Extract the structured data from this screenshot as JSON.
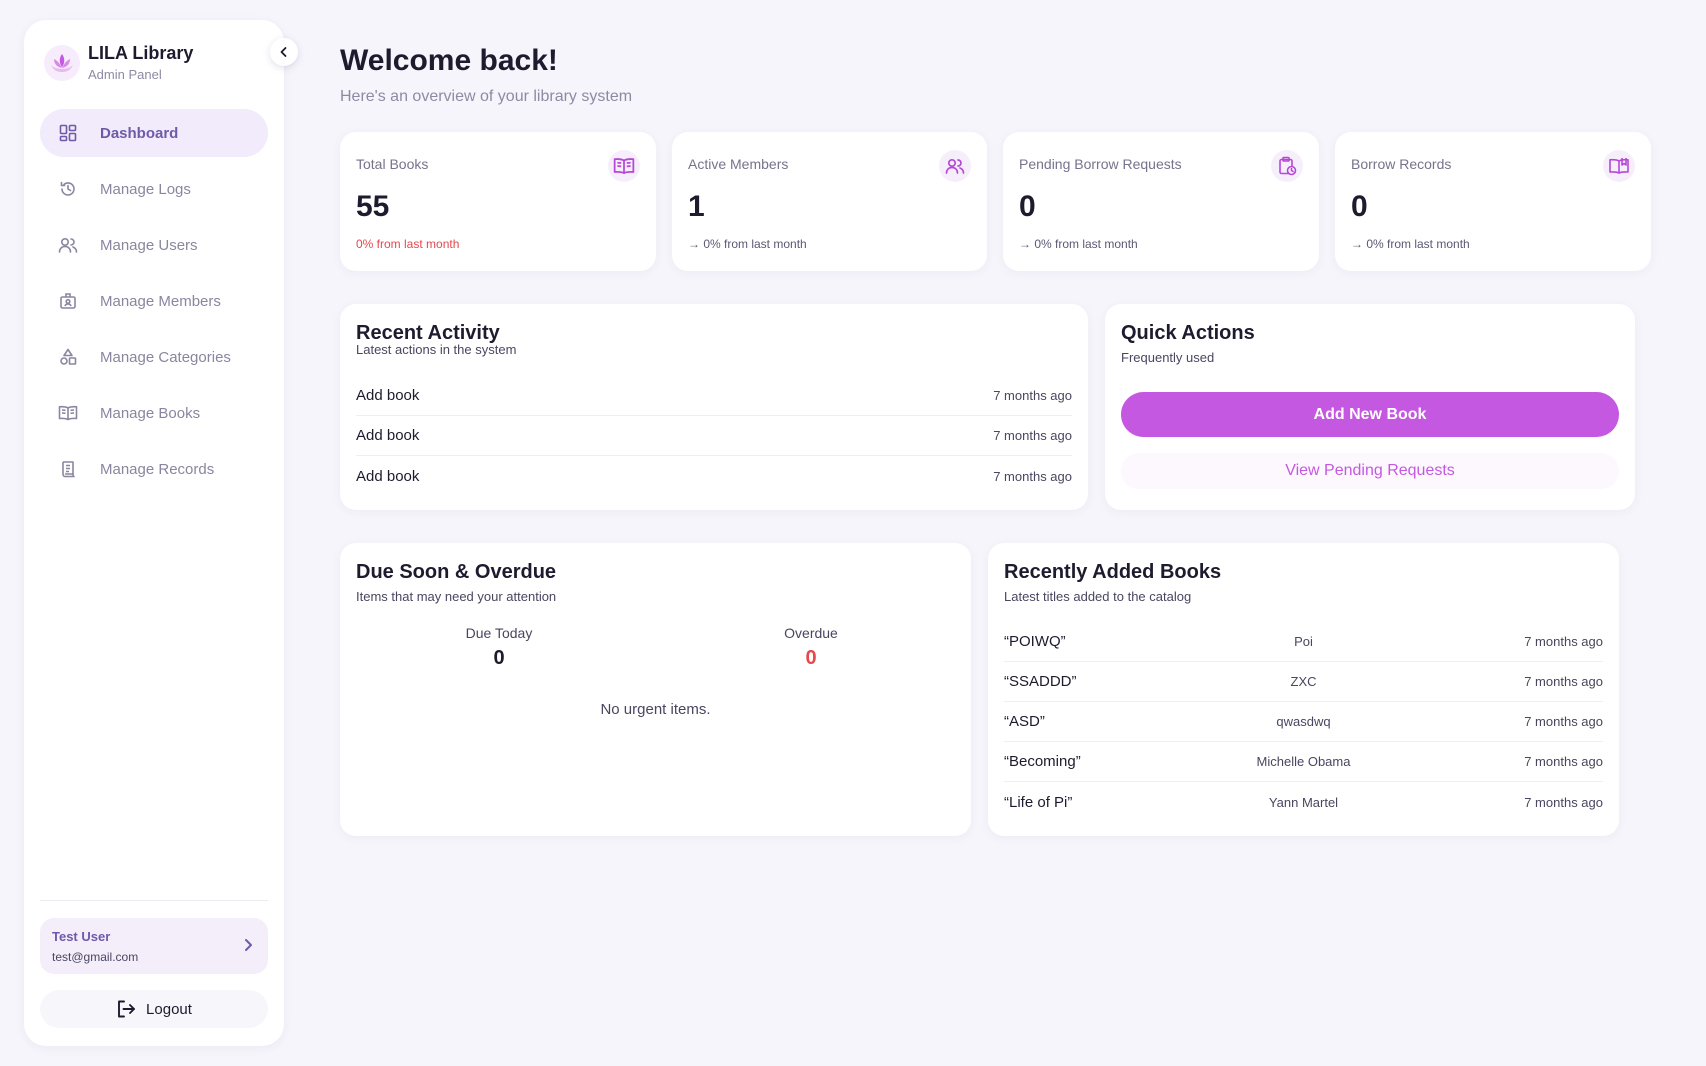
{
  "sidebar": {
    "brand_title": "LILA Library",
    "brand_sub": "Admin Panel",
    "items": [
      {
        "label": "Dashboard",
        "icon": "grid-icon",
        "active": true
      },
      {
        "label": "Manage Logs",
        "icon": "history-icon"
      },
      {
        "label": "Manage Users",
        "icon": "users-icon"
      },
      {
        "label": "Manage Members",
        "icon": "id-card-icon"
      },
      {
        "label": "Manage Categories",
        "icon": "shapes-icon"
      },
      {
        "label": "Manage Books",
        "icon": "book-open-icon"
      },
      {
        "label": "Manage Records",
        "icon": "scroll-icon"
      }
    ],
    "user": {
      "name": "Test User",
      "email": "test@gmail.com"
    },
    "logout_label": "Logout"
  },
  "header": {
    "title": "Welcome back!",
    "subtitle": "Here's an overview of your library system"
  },
  "stats": [
    {
      "label": "Total Books",
      "value": "55",
      "change": "0% from last month",
      "icon": "book-open-icon"
    },
    {
      "label": "Active Members",
      "value": "1",
      "change": "→ 0% from last month",
      "icon": "users-icon"
    },
    {
      "label": "Pending Borrow Requests",
      "value": "0",
      "change": "→ 0% from last month",
      "icon": "clipboard-clock-icon"
    },
    {
      "label": "Borrow Records",
      "value": "0",
      "change": "→ 0% from last month",
      "icon": "book-reading-icon"
    }
  ],
  "recent_activity": {
    "title": "Recent Activity",
    "subtitle": "Latest actions in the system",
    "rows": [
      {
        "action": "Add book",
        "time": "7 months ago"
      },
      {
        "action": "Add book",
        "time": "7 months ago"
      },
      {
        "action": "Add book",
        "time": "7 months ago"
      }
    ]
  },
  "quick_actions": {
    "title": "Quick Actions",
    "subtitle": "Frequently used",
    "primary_label": "Add New Book",
    "secondary_label": "View Pending Requests"
  },
  "due": {
    "title": "Due Soon & Overdue",
    "subtitle": "Items that may need your attention",
    "due_today_label": "Due Today",
    "due_today_value": "0",
    "overdue_label": "Overdue",
    "overdue_value": "0",
    "empty_text": "No urgent items."
  },
  "recent_books": {
    "title": "Recently Added Books",
    "subtitle": "Latest titles added to the catalog",
    "rows": [
      {
        "title": "“POIWQ”",
        "author": "Poi",
        "time": "7 months ago"
      },
      {
        "title": "“SSADDD”",
        "author": "ZXC",
        "time": "7 months ago"
      },
      {
        "title": "“ASD”",
        "author": "qwasdwq",
        "time": "7 months ago"
      },
      {
        "title": "“Becoming”",
        "author": "Michelle Obama",
        "time": "7 months ago"
      },
      {
        "title": "“Life of Pi”",
        "author": "Yann Martel",
        "time": "7 months ago"
      }
    ]
  },
  "colors": {
    "accent": "#c558e0",
    "nav_active_bg": "#f1ebfb",
    "nav_active_text": "#6f5aa9",
    "danger": "#e5484d"
  }
}
